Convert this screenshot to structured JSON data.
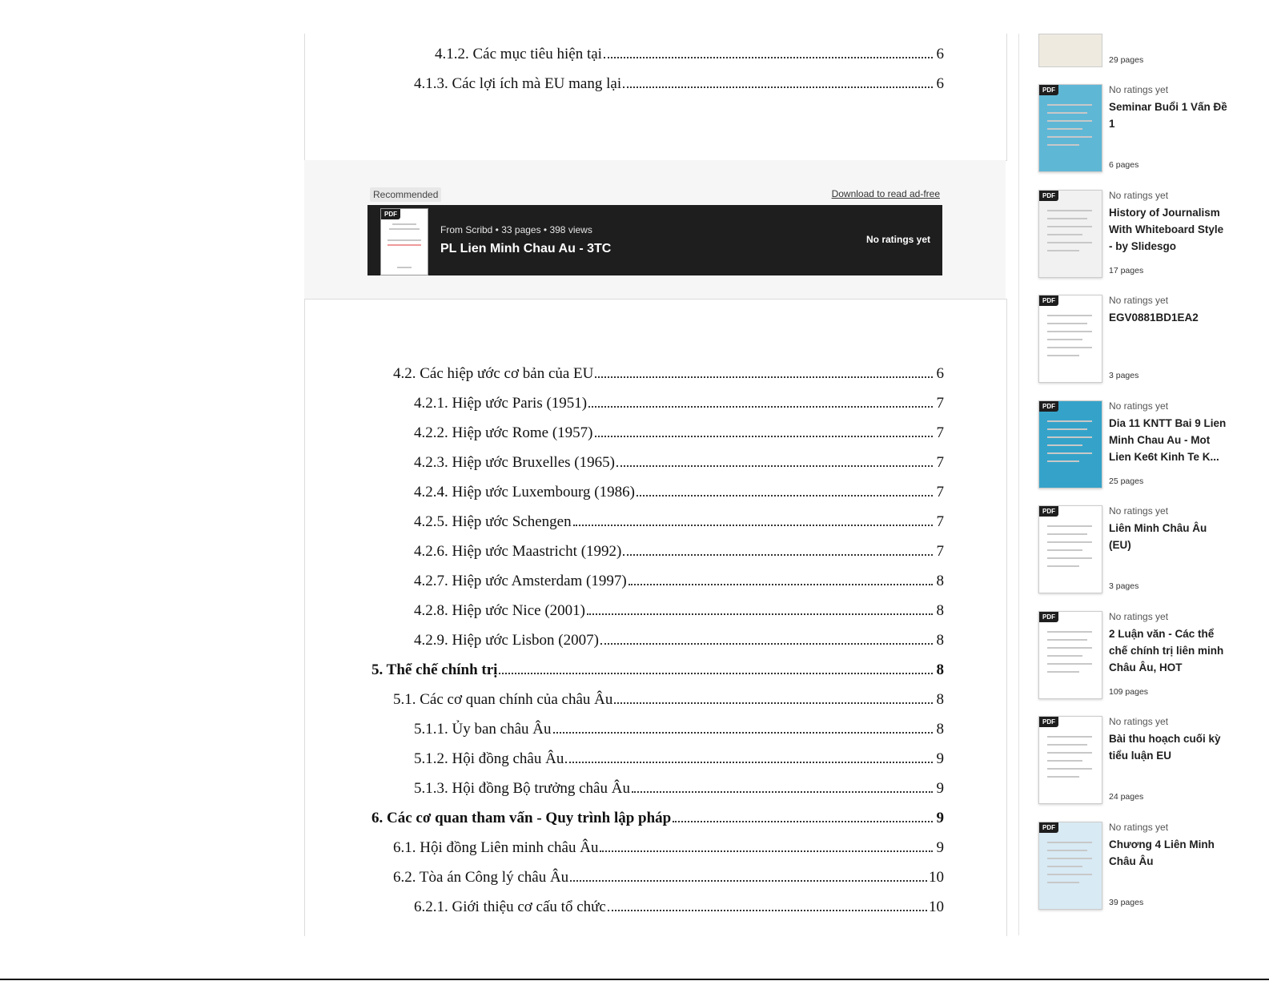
{
  "toc_top": [
    {
      "text": "4.1.2. Các mục tiêu hiện tại",
      "page": "6",
      "level": 4
    },
    {
      "text": "4.1.3. Các lợi ích mà EU mang lại",
      "page": "6",
      "level": 3
    }
  ],
  "recommended": {
    "label": "Recommended",
    "download_link": "Download to read ad-free",
    "badge": "PDF",
    "meta": "From Scribd • 33 pages • 398 views",
    "title": "PL Lien Minh Chau Au - 3TC",
    "rating": "No ratings yet"
  },
  "toc_main": [
    {
      "text": "4.2. Các hiệp ước cơ bản của EU",
      "page": "6",
      "level": 2
    },
    {
      "text": "4.2.1. Hiệp ước Paris (1951)",
      "page": "7",
      "level": 3
    },
    {
      "text": "4.2.2. Hiệp ước Rome (1957)",
      "page": "7",
      "level": 3
    },
    {
      "text": "4.2.3. Hiệp ước Bruxelles (1965)",
      "page": "7",
      "level": 3
    },
    {
      "text": "4.2.4. Hiệp ước Luxembourg (1986)",
      "page": "7",
      "level": 3
    },
    {
      "text": "4.2.5. Hiệp ước Schengen",
      "page": "7",
      "level": 3
    },
    {
      "text": "4.2.6. Hiệp ước Maastricht (1992)",
      "page": "7",
      "level": 3
    },
    {
      "text": "4.2.7. Hiệp ước Amsterdam (1997)",
      "page": "8",
      "level": 3
    },
    {
      "text": "4.2.8. Hiệp ước Nice (2001)",
      "page": "8",
      "level": 3
    },
    {
      "text": "4.2.9. Hiệp ước Lisbon (2007)",
      "page": "8",
      "level": 3
    },
    {
      "text": "5. Thể chế chính trị",
      "page": "8",
      "level": 1,
      "bold": true
    },
    {
      "text": "5.1. Các cơ quan chính của châu Âu",
      "page": "8",
      "level": 2
    },
    {
      "text": "5.1.1. Ủy ban châu Âu",
      "page": "8",
      "level": 3
    },
    {
      "text": "5.1.2. Hội đồng châu Âu",
      "page": "9",
      "level": 3
    },
    {
      "text": "5.1.3. Hội đồng Bộ trưởng châu Âu",
      "page": "9",
      "level": 3
    },
    {
      "text": "6. Các cơ quan tham vấn - Quy trình lập pháp",
      "page": "9",
      "level": 1,
      "bold": true
    },
    {
      "text": "6.1. Hội đồng Liên minh châu Âu",
      "page": "9",
      "level": 2
    },
    {
      "text": "6.2. Tòa án Công lý châu Âu",
      "page": "10",
      "level": 2
    },
    {
      "text": "6.2.1. Giới thiệu cơ cấu tổ chức",
      "page": "10",
      "level": 3
    }
  ],
  "sidebar": {
    "top_pages": "29 pages",
    "badge": "PDF",
    "items": [
      {
        "rating": "No ratings yet",
        "title": "Seminar Buổi 1 Vấn Đề 1",
        "pages": "6 pages",
        "thumb_color": "#5fb7d6"
      },
      {
        "rating": "No ratings yet",
        "title": "History of Journalism With Whiteboard Style - by Slidesgo",
        "pages": "17 pages",
        "thumb_color": "#f1f1f1"
      },
      {
        "rating": "No ratings yet",
        "title": "EGV0881BD1EA2",
        "pages": "3 pages",
        "thumb_color": "#ffffff"
      },
      {
        "rating": "No ratings yet",
        "title": "Dia 11 KNTT Bai 9 Lien Minh Chau Au - Mot Lien Ke6t Kinh Te K...",
        "pages": "25 pages",
        "thumb_color": "#35a3c9"
      },
      {
        "rating": "No ratings yet",
        "title": "Liên Minh Châu Âu (EU)",
        "pages": "3 pages",
        "thumb_color": "#ffffff"
      },
      {
        "rating": "No ratings yet",
        "title": "2 Luận văn - Các thể chế chính trị liên minh Châu Âu, HOT",
        "pages": "109 pages",
        "thumb_color": "#ffffff"
      },
      {
        "rating": "No ratings yet",
        "title": "Bài thu hoạch cuối kỳ tiểu luận EU",
        "pages": "24 pages",
        "thumb_color": "#ffffff"
      },
      {
        "rating": "No ratings yet",
        "title": "Chương 4 Liên Minh Châu Âu",
        "pages": "39 pages",
        "thumb_color": "#d8eaf4"
      }
    ]
  }
}
